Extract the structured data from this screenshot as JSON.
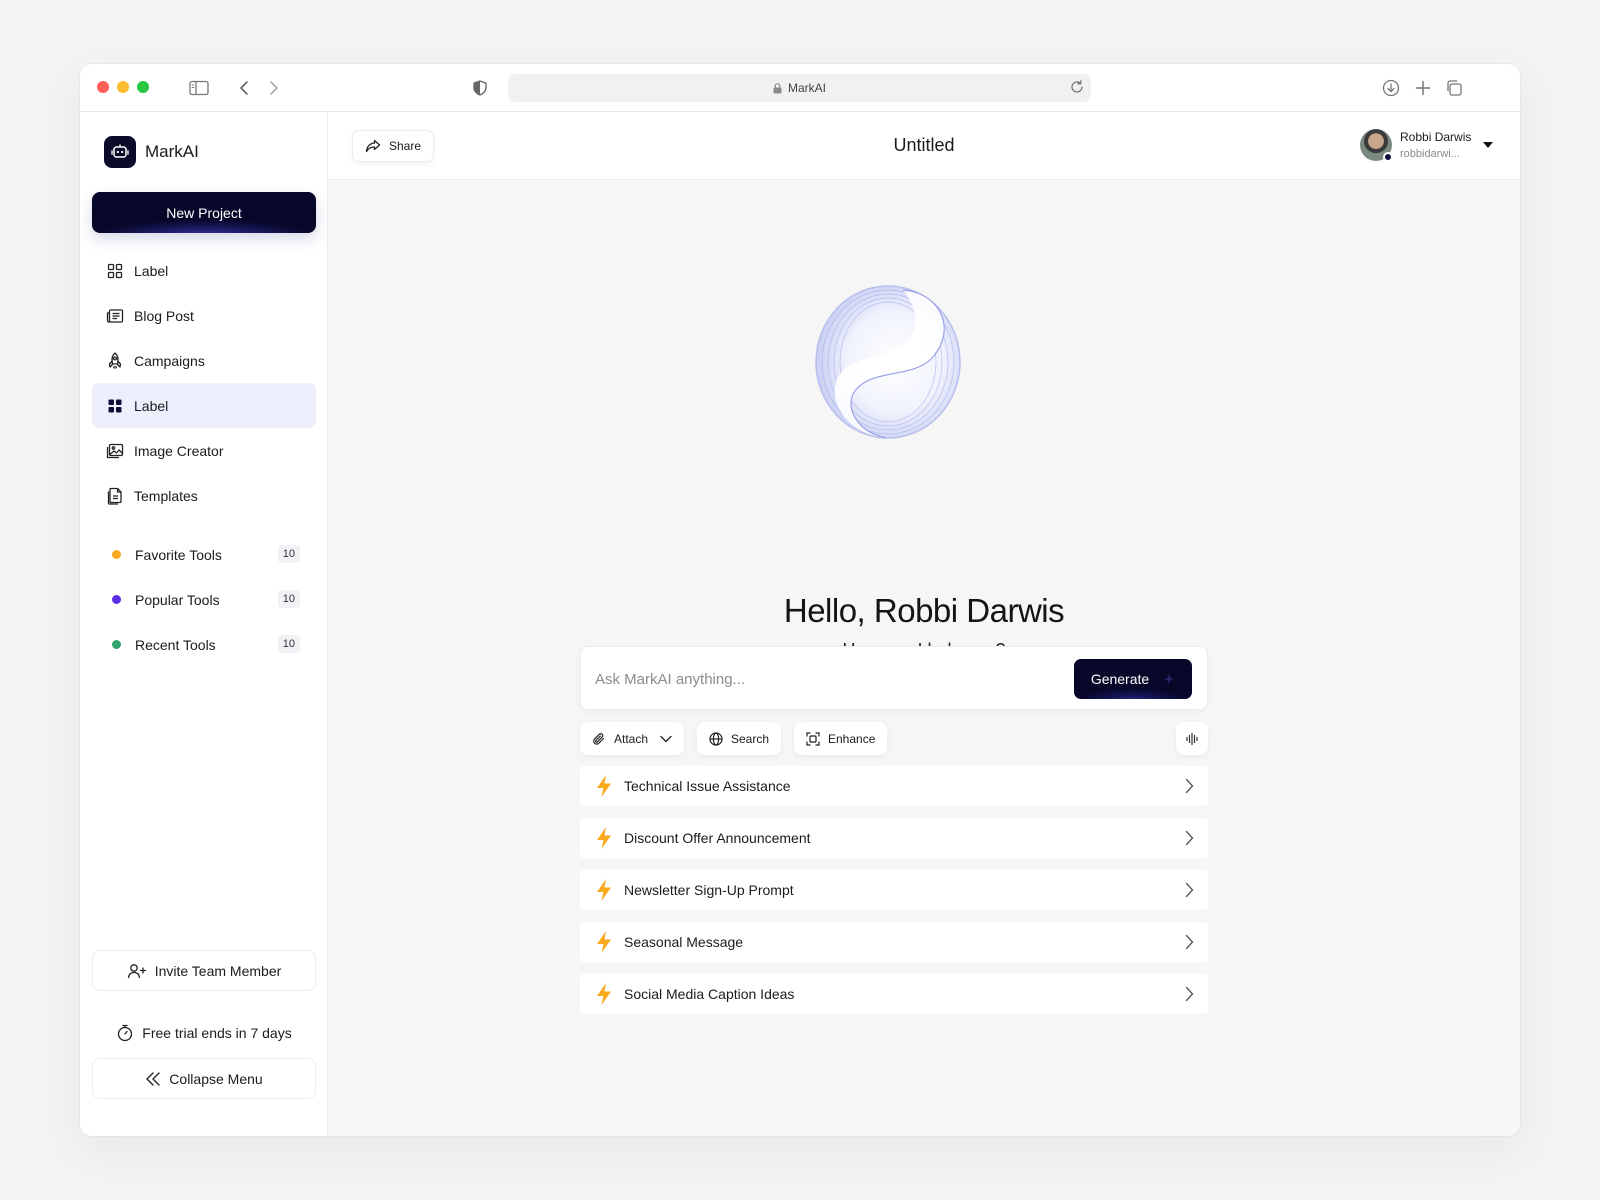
{
  "browser": {
    "url_text": "MarkAI"
  },
  "sidebar": {
    "brand_name": "MarkAI",
    "new_project_label": "New Project",
    "nav": [
      {
        "label": "Label",
        "icon": "grid-outline-icon"
      },
      {
        "label": "Blog Post",
        "icon": "newspaper-icon"
      },
      {
        "label": "Campaigns",
        "icon": "rocket-icon"
      },
      {
        "label": "Label",
        "icon": "grid-filled-icon",
        "active": true
      },
      {
        "label": "Image Creator",
        "icon": "image-icon"
      },
      {
        "label": "Templates",
        "icon": "document-icon"
      }
    ],
    "tools": [
      {
        "label": "Favorite Tools",
        "count": "10",
        "color": "#f9a91b"
      },
      {
        "label": "Popular Tools",
        "count": "10",
        "color": "#5b2ee6"
      },
      {
        "label": "Recent Tools",
        "count": "10",
        "color": "#2fa36b"
      }
    ],
    "invite_label": "Invite Team Member",
    "trial_label": "Free trial ends in 7 days",
    "collapse_label": "Collapse Menu"
  },
  "header": {
    "share_label": "Share",
    "title": "Untitled",
    "user_name": "Robbi Darwis",
    "user_email": "robbidarwi..."
  },
  "main": {
    "greeting": "Hello, Robbi Darwis",
    "subtitle": "How can I help you?",
    "input_placeholder": "Ask MarkAI anything...",
    "generate_label": "Generate",
    "chips": {
      "attach": "Attach",
      "search": "Search",
      "enhance": "Enhance"
    },
    "suggestions": [
      "Technical Issue Assistance",
      "Discount Offer Announcement",
      "Newsletter Sign-Up Prompt",
      "Seasonal Message",
      "Social Media Caption Ideas"
    ]
  },
  "colors": {
    "primary": "#07072a",
    "active_bg": "#eeeffc",
    "bolt": "#f9a91b"
  }
}
